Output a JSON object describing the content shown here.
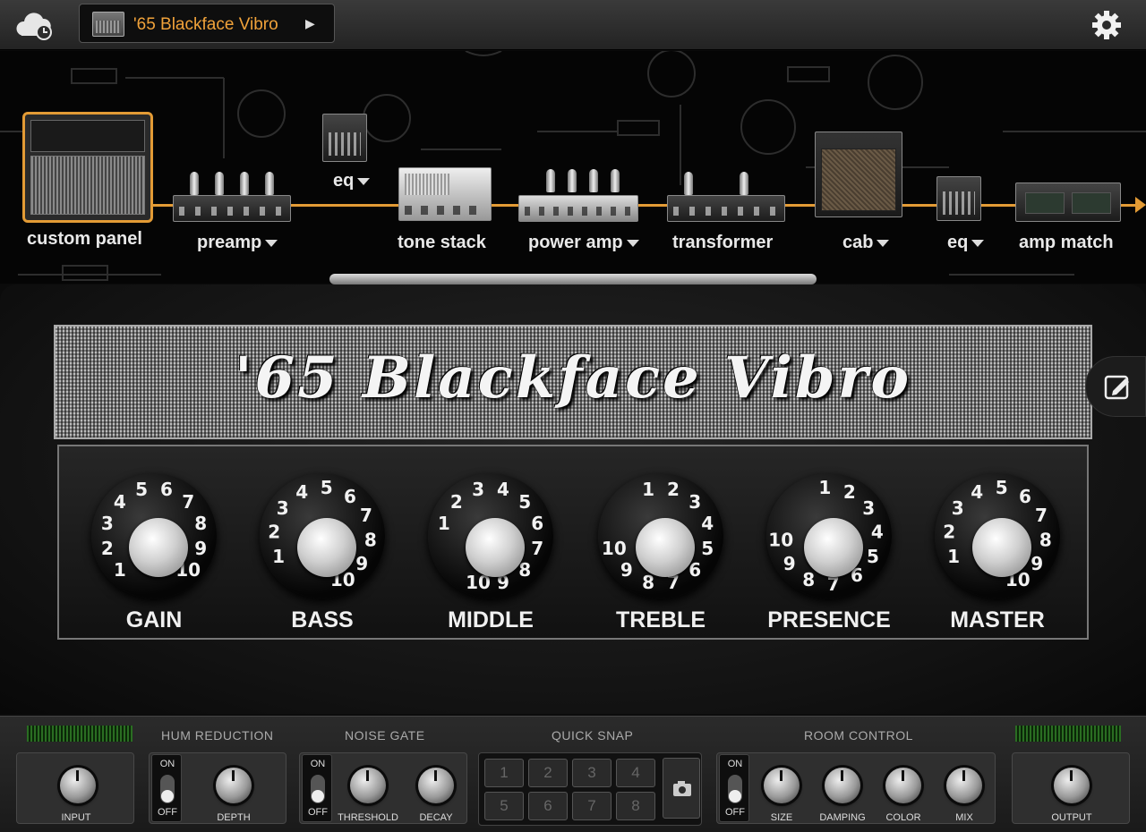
{
  "topbar": {
    "preset_name": "'65 Blackface Vibro",
    "cloud_icon": "cloud-icon",
    "settings_icon": "gear-icon"
  },
  "chain": {
    "modules": [
      {
        "id": "custom-panel",
        "label": "custom panel"
      },
      {
        "id": "preamp",
        "label": "preamp",
        "dropdown": true
      },
      {
        "id": "eq-pre",
        "label": "eq",
        "dropdown": true
      },
      {
        "id": "tone-stack",
        "label": "tone stack"
      },
      {
        "id": "power-amp",
        "label": "power amp",
        "dropdown": true
      },
      {
        "id": "transformer",
        "label": "transformer"
      },
      {
        "id": "cab",
        "label": "cab",
        "dropdown": true
      },
      {
        "id": "eq-post",
        "label": "eq",
        "dropdown": true
      },
      {
        "id": "amp-match",
        "label": "amp match"
      }
    ],
    "accent_color": "#e39b35"
  },
  "amp": {
    "title": "'65 Blackface Vibro",
    "knobs": [
      {
        "label": "GAIN"
      },
      {
        "label": "BASS"
      },
      {
        "label": "MIDDLE"
      },
      {
        "label": "TREBLE"
      },
      {
        "label": "PRESENCE"
      },
      {
        "label": "MASTER"
      }
    ],
    "dial_numbers": [
      "1",
      "2",
      "3",
      "4",
      "5",
      "6",
      "7",
      "8",
      "9",
      "10"
    ]
  },
  "bottom": {
    "sections": {
      "hum": "HUM REDUCTION",
      "noise": "NOISE GATE",
      "snap": "QUICK SNAP",
      "room": "ROOM CONTROL"
    },
    "input_label": "INPUT",
    "depth_label": "DEPTH",
    "threshold_label": "THRESHOLD",
    "decay_label": "DECAY",
    "size_label": "SIZE",
    "damping_label": "DAMPING",
    "color_label": "COLOR",
    "mix_label": "MIX",
    "output_label": "OUTPUT",
    "on_label": "ON",
    "off_label": "OFF",
    "snap_slots": [
      "1",
      "2",
      "3",
      "4",
      "5",
      "6",
      "7",
      "8"
    ],
    "meter_color": "#2a6d22"
  }
}
